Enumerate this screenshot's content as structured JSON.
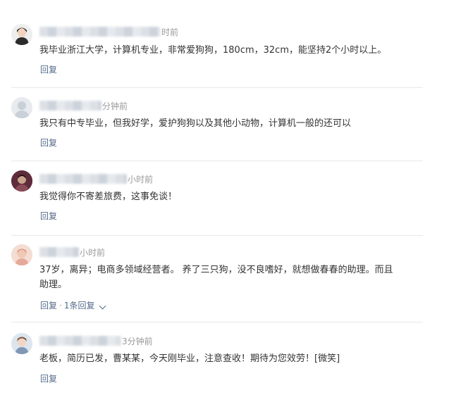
{
  "comments": [
    {
      "time": "时前",
      "text": "我毕业浙江大学，计算机专业，非常爱狗狗，180cm，32cm，能坚持2个小时以上。",
      "reply_label": "回复",
      "avatar_color": "#2b2b2b"
    },
    {
      "time": "分钟前",
      "text": "我只有中专毕业，但我好学，爱护狗狗以及其他小动物，计算机一般的还可以",
      "reply_label": "回复",
      "avatar_color": "#d8dde3"
    },
    {
      "time": "小时前",
      "text": "我觉得你不寄差旅费，这事免谈！",
      "reply_label": "回复",
      "avatar_color": "#7a3a48"
    },
    {
      "time": "小时前",
      "text_line1": "37岁，离异；电商多领域经营者。 养了三只狗，没不良嗜好，就想做春春的助理。而且",
      "text_line2": "助理。",
      "reply_label": "回复",
      "sub_reply_label": "1条回复",
      "avatar_color": "#e9b9a8"
    },
    {
      "time": "3分钟前",
      "text": "老板，简历已发，曹某某，今天刚毕业，注意查收！期待为您效劳！[微笑]",
      "reply_label": "回复",
      "avatar_color": "#b8c7d8"
    }
  ]
}
